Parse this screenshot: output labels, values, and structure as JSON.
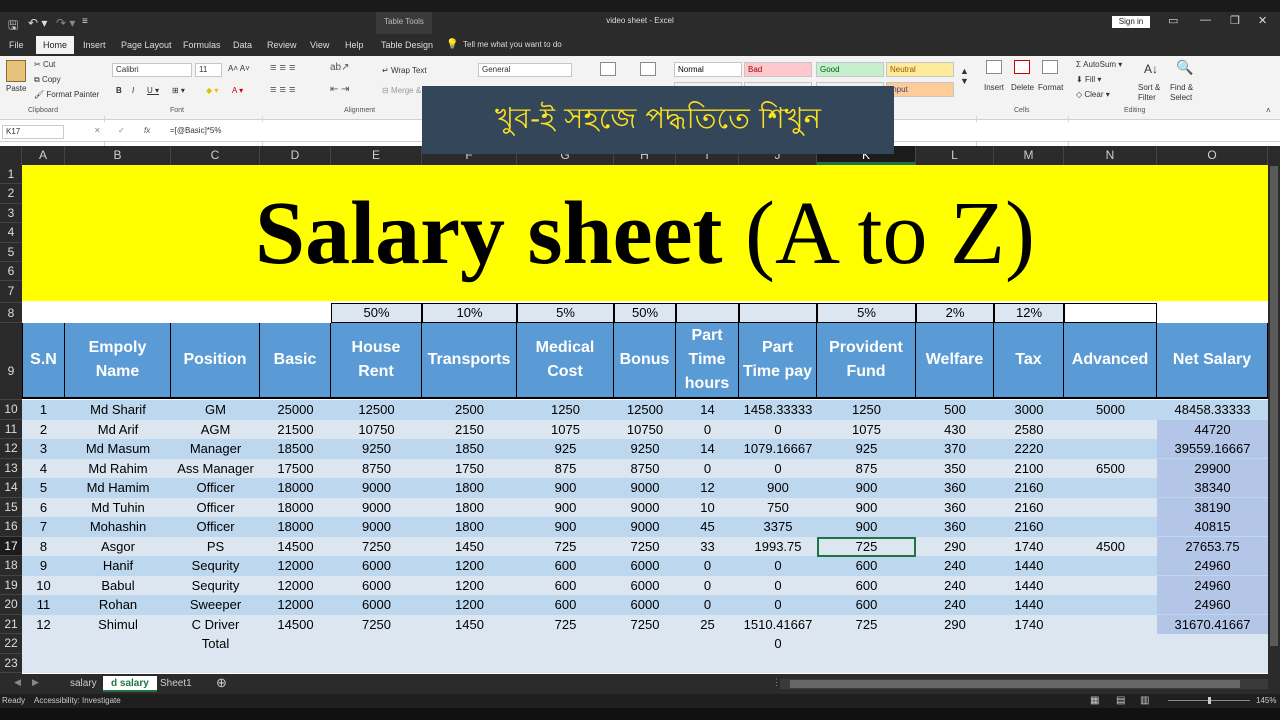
{
  "window": {
    "title": "video sheet  -  Excel",
    "table_tools": "Table Tools",
    "sign_in": "Sign in"
  },
  "tabs": [
    "File",
    "Home",
    "Insert",
    "Page Layout",
    "Formulas",
    "Data",
    "Review",
    "View",
    "Help",
    "Table Design"
  ],
  "tell_me": "Tell me what you want to do",
  "ribbon": {
    "paste": "Paste",
    "cut": "Cut",
    "copy": "Copy",
    "format_painter": "Format Painter",
    "clipboard": "Clipboard",
    "font_name": "Calibri",
    "font_size": "11",
    "font_group": "Font",
    "wrap_text": "Wrap Text",
    "merge": "Merge & ...",
    "alignment": "Alignment",
    "number_format": "General",
    "styles": [
      {
        "label": "Normal",
        "bg": "#ffffff",
        "color": "#000000"
      },
      {
        "label": "Bad",
        "bg": "#ffc7ce",
        "color": "#9c0006"
      },
      {
        "label": "Good",
        "bg": "#c6efce",
        "color": "#006100"
      },
      {
        "label": "Neutral",
        "bg": "#ffeb9c",
        "color": "#9c5700"
      },
      {
        "label": "Input",
        "bg": "#ffcc99",
        "color": "#3f3f76"
      }
    ],
    "insert": "Insert",
    "delete": "Delete",
    "format": "Format",
    "cells": "Cells",
    "autosum": "AutoSum",
    "fill": "Fill",
    "clear": "Clear",
    "sort_filter": "Sort & Filter",
    "find_select": "Find & Select",
    "editing": "Editing"
  },
  "formula_bar": {
    "name_box": "K17",
    "formula": "=[@Basic]*5%"
  },
  "banner": "খুব-ই সহজে পদ্ধতিতে শিখুন",
  "title": {
    "main": "Salary sheet",
    "sub": "(A to Z)"
  },
  "columns": [
    "A",
    "B",
    "C",
    "D",
    "E",
    "F",
    "G",
    "H",
    "I",
    "J",
    "K",
    "L",
    "M",
    "N",
    "O"
  ],
  "rows": [
    "1",
    "2",
    "3",
    "4",
    "5",
    "6",
    "7",
    "8",
    "9",
    "10",
    "11",
    "12",
    "13",
    "14",
    "15",
    "16",
    "17",
    "18",
    "19",
    "20",
    "21",
    "22",
    "23"
  ],
  "percents": [
    "50%",
    "10%",
    "5%",
    "50%",
    "5%",
    "2%",
    "12%"
  ],
  "headers": [
    "S.N",
    "Empoly Name",
    "Position",
    "Basic",
    "House Rent",
    "Transports",
    "Medical Cost",
    "Bonus",
    "Part Time hours",
    "Part Time pay",
    "Provident Fund",
    "Welfare",
    "Tax",
    "Advanced",
    "Net Salary"
  ],
  "data": [
    [
      "1",
      "Md Sharif",
      "GM",
      "25000",
      "12500",
      "2500",
      "1250",
      "12500",
      "14",
      "1458.33333",
      "1250",
      "500",
      "3000",
      "5000",
      "48458.33333"
    ],
    [
      "2",
      "Md Arif",
      "AGM",
      "21500",
      "10750",
      "2150",
      "1075",
      "10750",
      "0",
      "0",
      "1075",
      "430",
      "2580",
      "",
      "44720"
    ],
    [
      "3",
      "Md Masum",
      "Manager",
      "18500",
      "9250",
      "1850",
      "925",
      "9250",
      "14",
      "1079.16667",
      "925",
      "370",
      "2220",
      "",
      "39559.16667"
    ],
    [
      "4",
      "Md Rahim",
      "Ass Manager",
      "17500",
      "8750",
      "1750",
      "875",
      "8750",
      "0",
      "0",
      "875",
      "350",
      "2100",
      "6500",
      "29900"
    ],
    [
      "5",
      "Md Hamim",
      "Officer",
      "18000",
      "9000",
      "1800",
      "900",
      "9000",
      "12",
      "900",
      "900",
      "360",
      "2160",
      "",
      "38340"
    ],
    [
      "6",
      "Md Tuhin",
      "Officer",
      "18000",
      "9000",
      "1800",
      "900",
      "9000",
      "10",
      "750",
      "900",
      "360",
      "2160",
      "",
      "38190"
    ],
    [
      "7",
      "Mohashin",
      "Officer",
      "18000",
      "9000",
      "1800",
      "900",
      "9000",
      "45",
      "3375",
      "900",
      "360",
      "2160",
      "",
      "40815"
    ],
    [
      "8",
      "Asgor",
      "PS",
      "14500",
      "7250",
      "1450",
      "725",
      "7250",
      "33",
      "1993.75",
      "725",
      "290",
      "1740",
      "4500",
      "27653.75"
    ],
    [
      "9",
      "Hanif",
      "Sequrity",
      "12000",
      "6000",
      "1200",
      "600",
      "6000",
      "0",
      "0",
      "600",
      "240",
      "1440",
      "",
      "24960"
    ],
    [
      "10",
      "Babul",
      "Sequrity",
      "12000",
      "6000",
      "1200",
      "600",
      "6000",
      "0",
      "0",
      "600",
      "240",
      "1440",
      "",
      "24960"
    ],
    [
      "11",
      "Rohan",
      "Sweeper",
      "12000",
      "6000",
      "1200",
      "600",
      "6000",
      "0",
      "0",
      "600",
      "240",
      "1440",
      "",
      "24960"
    ],
    [
      "12",
      "Shimul",
      "C Driver",
      "14500",
      "7250",
      "1450",
      "725",
      "7250",
      "25",
      "1510.41667",
      "725",
      "290",
      "1740",
      "",
      "31670.41667"
    ],
    [
      "",
      "",
      "Total",
      "",
      "",
      "",
      "",
      "",
      "",
      "0",
      "",
      "",
      "",
      "",
      ""
    ]
  ],
  "sheets": [
    "salary",
    "d salary",
    "Sheet1"
  ],
  "status": {
    "ready": "Ready",
    "accessibility": "Accessibility: Investigate",
    "zoom": "145%"
  },
  "colors": {
    "yellow": "#ffff00",
    "header_blue": "#5b9bd5",
    "band_light": "#dce6f1",
    "band_dark": "#bdd7ee",
    "excel_green": "#217346"
  }
}
